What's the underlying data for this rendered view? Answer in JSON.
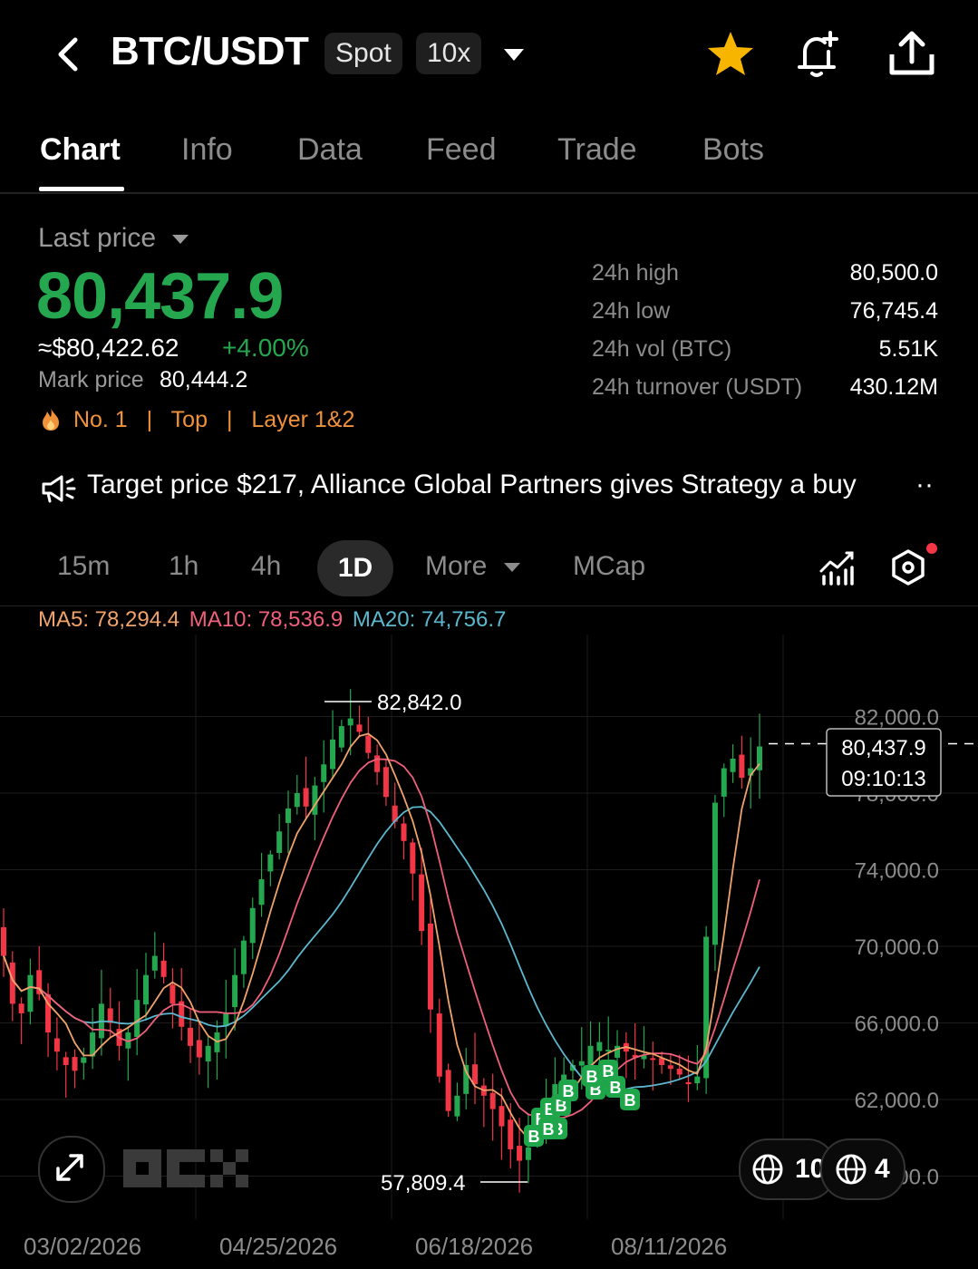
{
  "header": {
    "pair": "BTC/USDT",
    "market_type": "Spot",
    "leverage": "10x"
  },
  "tabs": [
    {
      "label": "Chart",
      "active": true
    },
    {
      "label": "Info"
    },
    {
      "label": "Data"
    },
    {
      "label": "Feed"
    },
    {
      "label": "Trade"
    },
    {
      "label": "Bots"
    }
  ],
  "price": {
    "label": "Last price",
    "last": "80,437.9",
    "usd": "≈$80,422.62",
    "change": "+4.00%",
    "mark_label": "Mark price",
    "mark_value": "80,444.2",
    "tags": [
      "No. 1",
      "Top",
      "Layer 1&2"
    ],
    "tag_sep": "|"
  },
  "stats": [
    {
      "label": "24h high",
      "value": "80,500.0"
    },
    {
      "label": "24h low",
      "value": "76,745.4"
    },
    {
      "label": "24h vol (BTC)",
      "value": "5.51K"
    },
    {
      "label": "24h turnover (USDT)",
      "value": "430.12M"
    }
  ],
  "news": {
    "text": "Target price $217, Alliance Global Partners gives Strategy a buy",
    "more": "··"
  },
  "intervals": [
    "15m",
    "1h",
    "4h",
    "1D",
    "More",
    "MCap"
  ],
  "ma": {
    "ma5": "MA5: 78,294.4",
    "ma10": "MA10: 78,536.9",
    "ma20": "MA20: 74,756.7"
  },
  "colors": {
    "up": "#25a750",
    "down": "#f23645",
    "ma5": "#f0a36a",
    "ma10": "#f0607a",
    "ma20": "#5cb8cf",
    "accent": "#f7b500"
  },
  "chart_data": {
    "type": "candlestick",
    "y_ticks": [
      "82,000.0",
      "78,000.0",
      "74,000.0",
      "70,000.0",
      "66,000.0",
      "62,000.0",
      "58,000.0"
    ],
    "x_labels": [
      "03/02/2026",
      "04/25/2026",
      "06/18/2026",
      "08/11/2026"
    ],
    "ylim": [
      56000,
      83500
    ],
    "high_label": "82,842.0",
    "low_label": "57,809.4",
    "current_price": "80,437.9",
    "countdown": "09:10:13",
    "high": 82842.0,
    "low": 57809.4,
    "close_path": [
      69500,
      67000,
      66500,
      68500,
      67500,
      65500,
      64500,
      63800,
      63500,
      64200,
      65500,
      67000,
      66000,
      64800,
      65500,
      67200,
      68500,
      69500,
      68400,
      67000,
      65800,
      64800,
      64200,
      64800,
      65500,
      66500,
      68500,
      70300,
      72000,
      73500,
      74800,
      76000,
      77200,
      78000,
      77300,
      78400,
      79500,
      80800,
      81500,
      81900,
      81200,
      80100,
      79100,
      77800,
      76500,
      75500,
      73800,
      70800,
      66700,
      63200,
      61400,
      62200,
      63800,
      62800,
      62200,
      61500,
      60600,
      59400,
      58800,
      59500,
      60500,
      62000,
      62800,
      63300,
      63800,
      64000,
      64800,
      65000,
      64600,
      64800,
      64500,
      64200,
      64300,
      64100,
      63800,
      63600,
      63300,
      62800,
      63200,
      70500,
      77500,
      79300,
      79800,
      78800,
      79300,
      80437.9
    ],
    "buy_markers": 12
  },
  "bottom_chips": [
    "10",
    "4"
  ],
  "watermark": "OKX"
}
